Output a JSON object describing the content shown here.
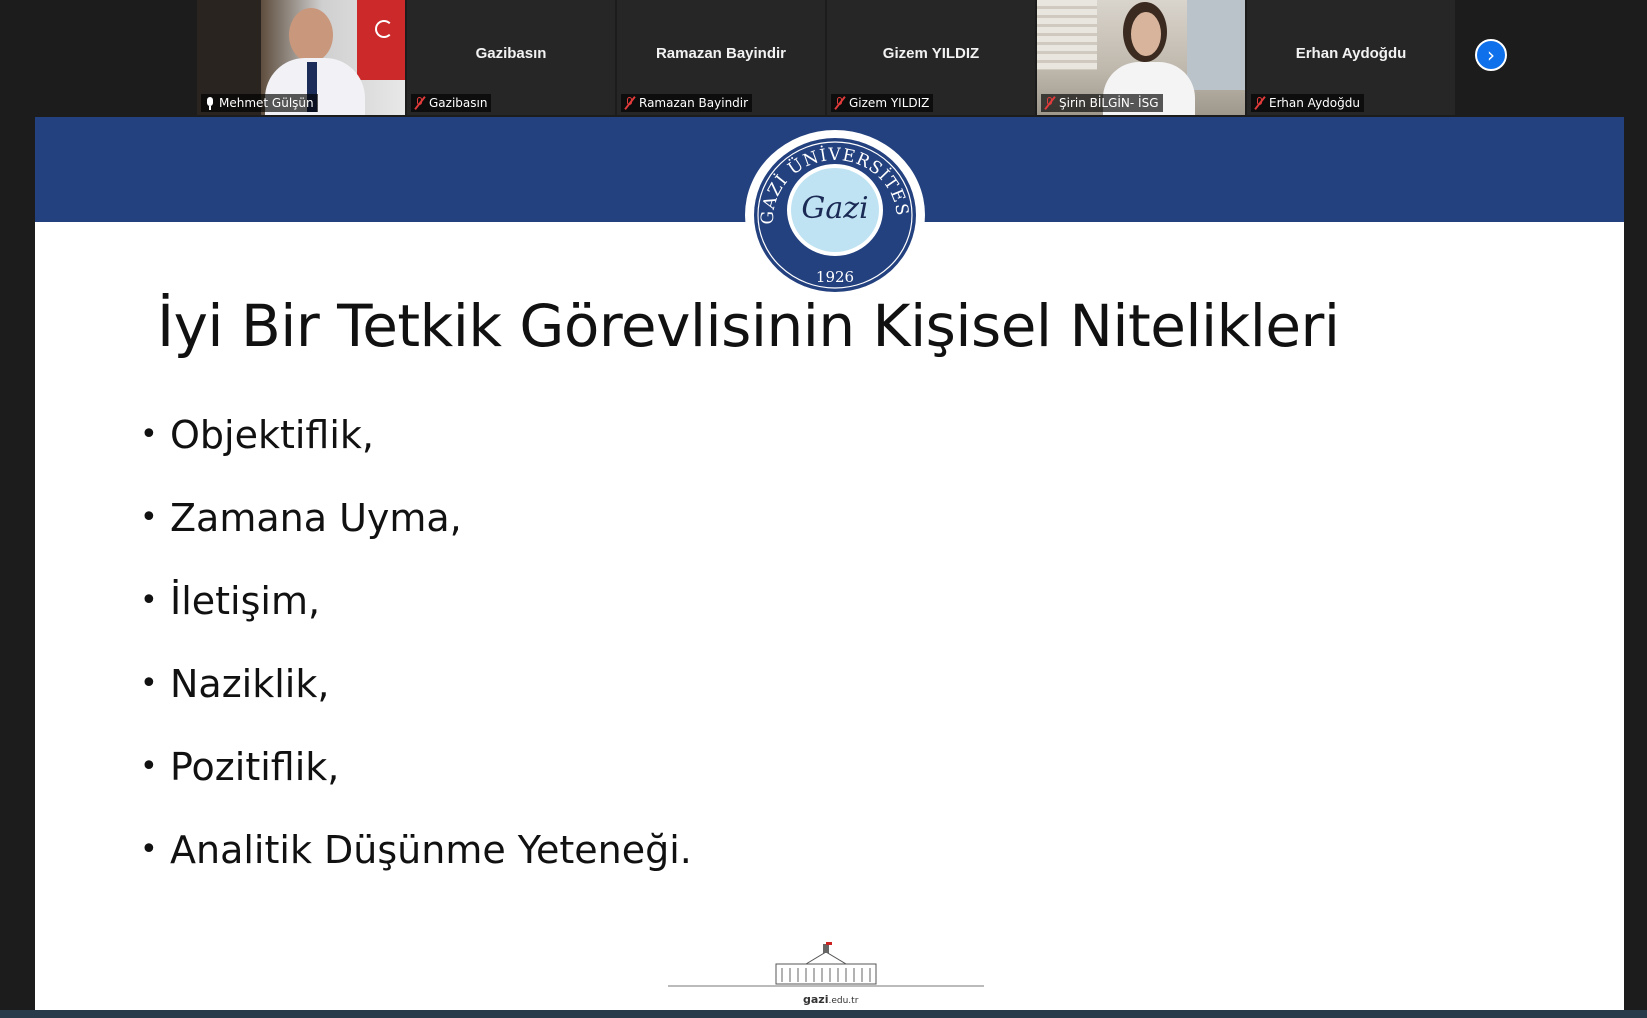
{
  "participants": [
    {
      "label": "Mehmet Gülşün",
      "center_name": "",
      "video": "man",
      "muted": false,
      "active": true
    },
    {
      "label": "Gazibasın",
      "center_name": "Gazibasın",
      "video": "none",
      "muted": true,
      "active": false
    },
    {
      "label": "Ramazan Bayindir",
      "center_name": "Ramazan Bayindir",
      "video": "none",
      "muted": true,
      "active": false
    },
    {
      "label": "Gizem YILDIZ",
      "center_name": "Gizem YILDIZ",
      "video": "none",
      "muted": true,
      "active": false
    },
    {
      "label": "Şirin BİLGİN- İSG",
      "center_name": "",
      "video": "woman",
      "muted": true,
      "active": false
    },
    {
      "label": "Erhan Aydoğdu",
      "center_name": "Erhan Aydoğdu",
      "video": "none",
      "muted": true,
      "active": false
    }
  ],
  "next_button_icon": "chevron-right-icon",
  "slide": {
    "header_color": "#24417f",
    "seal": {
      "top_text": "GAZİ ÜNİVERSİTESİ",
      "script": "Gazi",
      "year": "1926"
    },
    "title": "İyi Bir Tetkik Görevlisinin Kişisel Nitelikleri",
    "bullets": [
      "Objektiflik,",
      "Zamana Uyma,",
      "İletişim,",
      "Naziklik,",
      "Pozitiflik,",
      "Analitik Düşünme Yeteneği."
    ],
    "footer": {
      "brand": "gazi",
      "suffix": ".edu.tr"
    }
  }
}
